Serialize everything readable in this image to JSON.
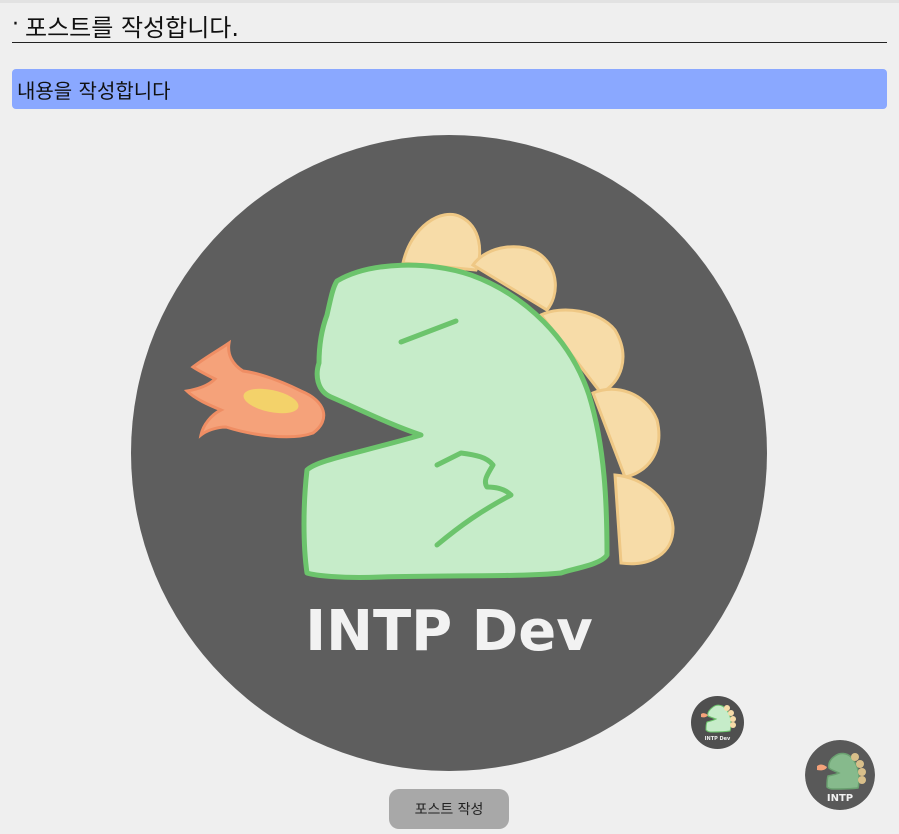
{
  "page": {
    "title": "포스트를 작성합니다.",
    "content_placeholder": "내용을 작성합니다"
  },
  "logo": {
    "text": "INTP Dev",
    "mini_text": "INTP Dev",
    "fab_text": "INTP"
  },
  "actions": {
    "submit_label": "포스트 작성"
  },
  "colors": {
    "background": "#efefef",
    "content_bar": "#8aa8ff",
    "logo_circle": "#5e5e5e",
    "dino_body": "#c6ecc9",
    "dino_outline": "#6cc46c",
    "spikes": "#f7dca8",
    "flame": "#f5a27a",
    "button": "#a8a8a8"
  }
}
